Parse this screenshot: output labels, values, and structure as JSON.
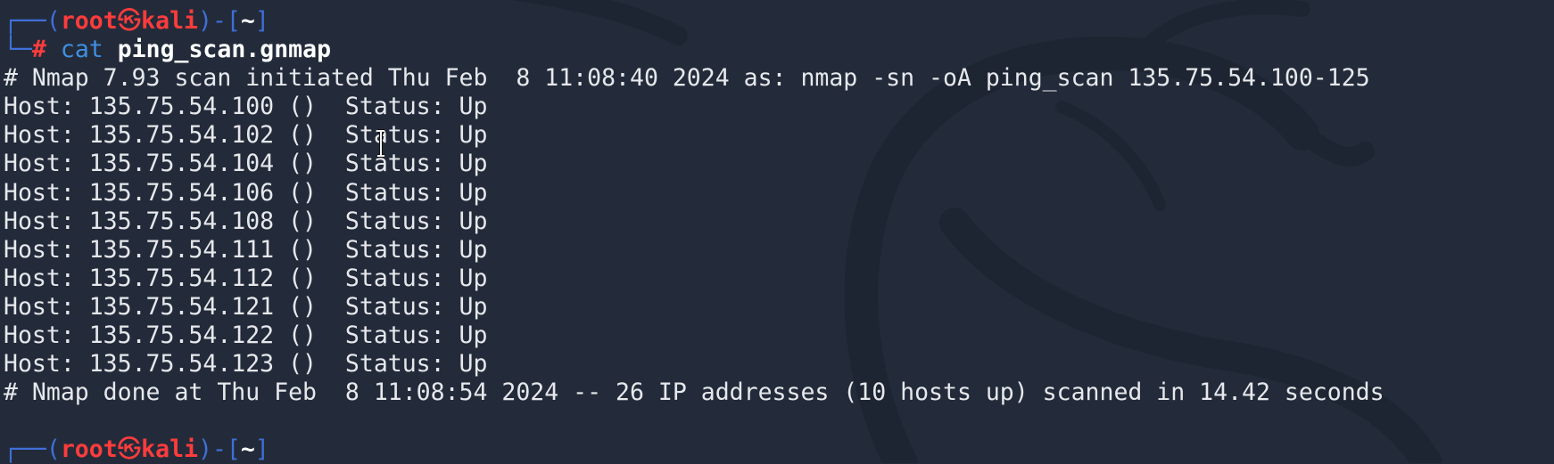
{
  "prompt": {
    "box_open": "┌──(",
    "user": "root",
    "skull": "㉿",
    "host": "kali",
    "box_mid": ")-[",
    "path": "~",
    "box_close": "]",
    "box_lower": "└─",
    "hash": "#"
  },
  "command": {
    "name": "cat",
    "argument": "ping_scan.gnmap"
  },
  "output": {
    "header": "# Nmap 7.93 scan initiated Thu Feb  8 11:08:40 2024 as: nmap -sn -oA ping_scan 135.75.54.100-125",
    "hosts": [
      "Host: 135.75.54.100 ()  Status: Up",
      "Host: 135.75.54.102 ()  Status: Up",
      "Host: 135.75.54.104 ()  Status: Up",
      "Host: 135.75.54.106 ()  Status: Up",
      "Host: 135.75.54.108 ()  Status: Up",
      "Host: 135.75.54.111 ()  Status: Up",
      "Host: 135.75.54.112 ()  Status: Up",
      "Host: 135.75.54.121 ()  Status: Up",
      "Host: 135.75.54.122 ()  Status: Up",
      "Host: 135.75.54.123 ()  Status: Up"
    ],
    "footer": "# Nmap done at Thu Feb  8 11:08:54 2024 -- 26 IP addresses (10 hosts up) scanned in 14.42 seconds"
  },
  "colors": {
    "background": "#232b3a",
    "text": "#e6e8ec",
    "prompt_box": "#3f6fd8",
    "prompt_user": "#ff3c3c",
    "command": "#3f8fe0"
  },
  "icons": {
    "background": "kali-dragon-watermark",
    "cursor": "text-cursor-icon"
  }
}
